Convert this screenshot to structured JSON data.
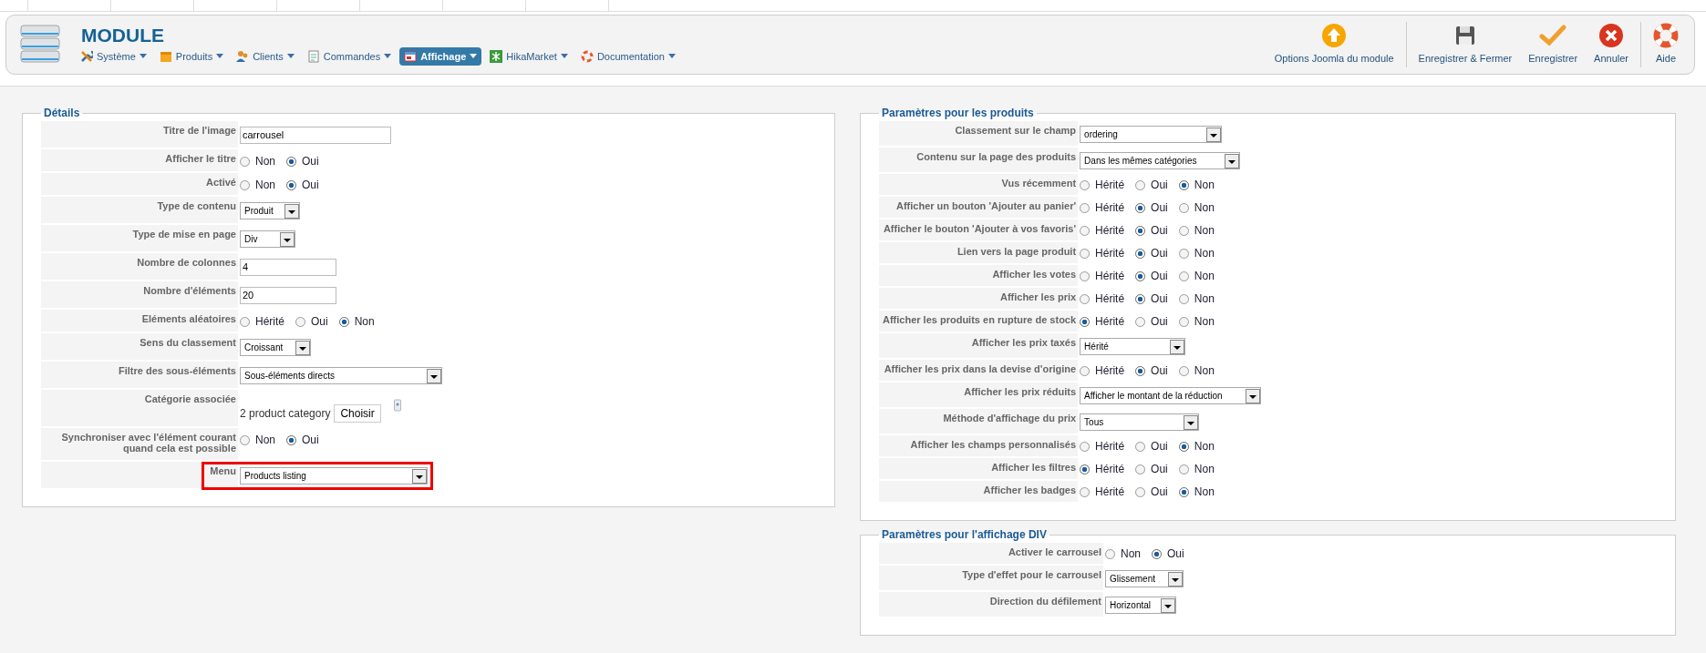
{
  "header": {
    "title": "MODULE",
    "menu": [
      {
        "label": "Système",
        "kind": "tools",
        "selected": false
      },
      {
        "label": "Produits",
        "kind": "box",
        "selected": false
      },
      {
        "label": "Clients",
        "kind": "users",
        "selected": false
      },
      {
        "label": "Commandes",
        "kind": "document",
        "selected": false
      },
      {
        "label": "Affichage",
        "kind": "display",
        "selected": true
      },
      {
        "label": "HikaMarket",
        "kind": "hika",
        "selected": false
      },
      {
        "label": "Documentation",
        "kind": "help",
        "selected": false
      }
    ],
    "toolbar": [
      {
        "label": "Options Joomla du module",
        "kind": "options"
      },
      {
        "label": "Enregistrer & Fermer",
        "kind": "save-close"
      },
      {
        "label": "Enregistrer",
        "kind": "save"
      },
      {
        "label": "Annuler",
        "kind": "cancel"
      },
      {
        "label": "Aide",
        "kind": "help"
      }
    ]
  },
  "details": {
    "legend": "Détails",
    "fields": [
      {
        "label": "Titre de l'image",
        "kind": "text",
        "value": "carrousel"
      },
      {
        "label": "Afficher le titre",
        "kind": "radio",
        "options": [
          {
            "label": "Non",
            "selected": false
          },
          {
            "label": "Oui",
            "selected": true
          }
        ]
      },
      {
        "label": "Activé",
        "kind": "radio",
        "options": [
          {
            "label": "Non",
            "selected": false
          },
          {
            "label": "Oui",
            "selected": true
          }
        ]
      },
      {
        "label": "Type de contenu",
        "kind": "select",
        "value": "Produit"
      },
      {
        "label": "Type de mise en page",
        "kind": "select",
        "value": "Div"
      },
      {
        "label": "Nombre de colonnes",
        "kind": "text",
        "value": "4"
      },
      {
        "label": "Nombre d'éléments",
        "kind": "text",
        "value": "20"
      },
      {
        "label": "Eléments aléatoires",
        "kind": "radio",
        "options": [
          {
            "label": "Hérité",
            "selected": false
          },
          {
            "label": "Oui",
            "selected": false
          },
          {
            "label": "Non",
            "selected": true
          }
        ]
      },
      {
        "label": "Sens du classement",
        "kind": "select",
        "value": "Croissant"
      },
      {
        "label": "Filtre des sous-éléments",
        "kind": "select",
        "value": "Sous-éléments directs"
      },
      {
        "label": "Catégorie associée",
        "kind": "category",
        "value": "2 product category",
        "button": "Choisir"
      },
      {
        "label": "Synchroniser avec l'élément courant quand cela est possible",
        "kind": "radio",
        "options": [
          {
            "label": "Non",
            "selected": false
          },
          {
            "label": "Oui",
            "selected": true
          }
        ]
      },
      {
        "label": "Menu",
        "kind": "select",
        "value": "Products listing",
        "highlighted": true
      }
    ]
  },
  "products": {
    "legend": "Paramètres pour les produits",
    "fields": [
      {
        "label": "Classement sur le champ",
        "kind": "select",
        "value": "ordering"
      },
      {
        "label": "Contenu sur la page des produits",
        "kind": "select",
        "value": "Dans les mêmes catégories"
      },
      {
        "label": "Vus récemment",
        "kind": "radio",
        "options": [
          {
            "label": "Hérité",
            "selected": false
          },
          {
            "label": "Oui",
            "selected": false
          },
          {
            "label": "Non",
            "selected": true
          }
        ]
      },
      {
        "label": "Afficher un bouton 'Ajouter au panier'",
        "kind": "radio",
        "options": [
          {
            "label": "Hérité",
            "selected": false
          },
          {
            "label": "Oui",
            "selected": true
          },
          {
            "label": "Non",
            "selected": false
          }
        ]
      },
      {
        "label": "Afficher le bouton 'Ajouter à vos favoris'",
        "kind": "radio",
        "options": [
          {
            "label": "Hérité",
            "selected": false
          },
          {
            "label": "Oui",
            "selected": true
          },
          {
            "label": "Non",
            "selected": false
          }
        ]
      },
      {
        "label": "Lien vers la page produit",
        "kind": "radio",
        "options": [
          {
            "label": "Hérité",
            "selected": false
          },
          {
            "label": "Oui",
            "selected": true
          },
          {
            "label": "Non",
            "selected": false
          }
        ]
      },
      {
        "label": "Afficher les votes",
        "kind": "radio",
        "options": [
          {
            "label": "Hérité",
            "selected": false
          },
          {
            "label": "Oui",
            "selected": true
          },
          {
            "label": "Non",
            "selected": false
          }
        ]
      },
      {
        "label": "Afficher les prix",
        "kind": "radio",
        "options": [
          {
            "label": "Hérité",
            "selected": false
          },
          {
            "label": "Oui",
            "selected": true
          },
          {
            "label": "Non",
            "selected": false
          }
        ]
      },
      {
        "label": "Afficher les produits en rupture de stock",
        "kind": "radio",
        "options": [
          {
            "label": "Hérité",
            "selected": true
          },
          {
            "label": "Oui",
            "selected": false
          },
          {
            "label": "Non",
            "selected": false
          }
        ]
      },
      {
        "label": "Afficher les prix taxés",
        "kind": "select",
        "value": "Hérité"
      },
      {
        "label": "Afficher les prix dans la devise d'origine",
        "kind": "radio",
        "options": [
          {
            "label": "Hérité",
            "selected": false
          },
          {
            "label": "Oui",
            "selected": true
          },
          {
            "label": "Non",
            "selected": false
          }
        ]
      },
      {
        "label": "Afficher les prix réduits",
        "kind": "select",
        "value": "Afficher le montant de la réduction"
      },
      {
        "label": "Méthode d'affichage du prix",
        "kind": "select",
        "value": "Tous"
      },
      {
        "label": "Afficher les champs personnalisés",
        "kind": "radio",
        "options": [
          {
            "label": "Hérité",
            "selected": false
          },
          {
            "label": "Oui",
            "selected": false
          },
          {
            "label": "Non",
            "selected": true
          }
        ]
      },
      {
        "label": "Afficher les filtres",
        "kind": "radio",
        "options": [
          {
            "label": "Hérité",
            "selected": true
          },
          {
            "label": "Oui",
            "selected": false
          },
          {
            "label": "Non",
            "selected": false
          }
        ]
      },
      {
        "label": "Afficher les badges",
        "kind": "radio",
        "options": [
          {
            "label": "Hérité",
            "selected": false
          },
          {
            "label": "Oui",
            "selected": false
          },
          {
            "label": "Non",
            "selected": true
          }
        ]
      }
    ]
  },
  "div_display": {
    "legend": "Paramètres pour l'affichage DIV",
    "fields": [
      {
        "label": "Activer le carrousel",
        "kind": "radio",
        "options": [
          {
            "label": "Non",
            "selected": false
          },
          {
            "label": "Oui",
            "selected": true
          }
        ]
      },
      {
        "label": "Type d'effet pour le carrousel",
        "kind": "select",
        "value": "Glissement"
      },
      {
        "label": "Direction du défilement",
        "kind": "select",
        "value": "Horizontal"
      }
    ]
  }
}
